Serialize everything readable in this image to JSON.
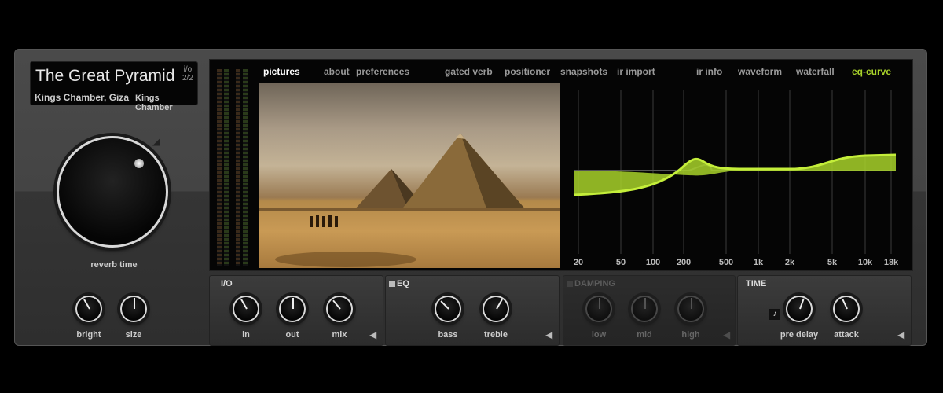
{
  "preset": {
    "name": "The Great Pyramid",
    "io_label": "i/o",
    "io_value": "2/2",
    "location": "Kings Chamber, Giza",
    "subtitle": "Kings Chamber"
  },
  "main_knob": {
    "label": "reverb time"
  },
  "left_knobs": [
    {
      "label": "bright"
    },
    {
      "label": "size"
    }
  ],
  "tabs": [
    {
      "label": "pictures",
      "active": true
    },
    {
      "label": "about"
    },
    {
      "label": "preferences"
    },
    {
      "label": "gated verb"
    },
    {
      "label": "positioner"
    },
    {
      "label": "snapshots"
    },
    {
      "label": "ir import"
    },
    {
      "label": "ir info"
    },
    {
      "label": "waveform"
    },
    {
      "label": "waterfall"
    },
    {
      "label": "eq-curve",
      "active": true
    }
  ],
  "eq_graph": {
    "freq_labels": [
      "20",
      "50",
      "100",
      "200",
      "500",
      "1k",
      "2k",
      "5k",
      "10k",
      "18k"
    ],
    "curve_color": "#a8d22a"
  },
  "sections": [
    {
      "title": "I/O",
      "knobs": [
        {
          "label": "in"
        },
        {
          "label": "out"
        },
        {
          "label": "mix"
        }
      ]
    },
    {
      "title": "EQ",
      "knobs": [
        {
          "label": "bass"
        },
        {
          "label": "treble"
        }
      ],
      "enabled": true
    },
    {
      "title": "DAMPING",
      "knobs": [
        {
          "label": "low"
        },
        {
          "label": "mid"
        },
        {
          "label": "high"
        }
      ],
      "enabled": false
    },
    {
      "title": "TIME",
      "knobs": [
        {
          "label": "pre delay"
        },
        {
          "label": "attack"
        }
      ],
      "sync_icon": "music-note-icon"
    }
  ],
  "colors": {
    "accent": "#a8d22a",
    "active_tab": "#ffffff"
  }
}
